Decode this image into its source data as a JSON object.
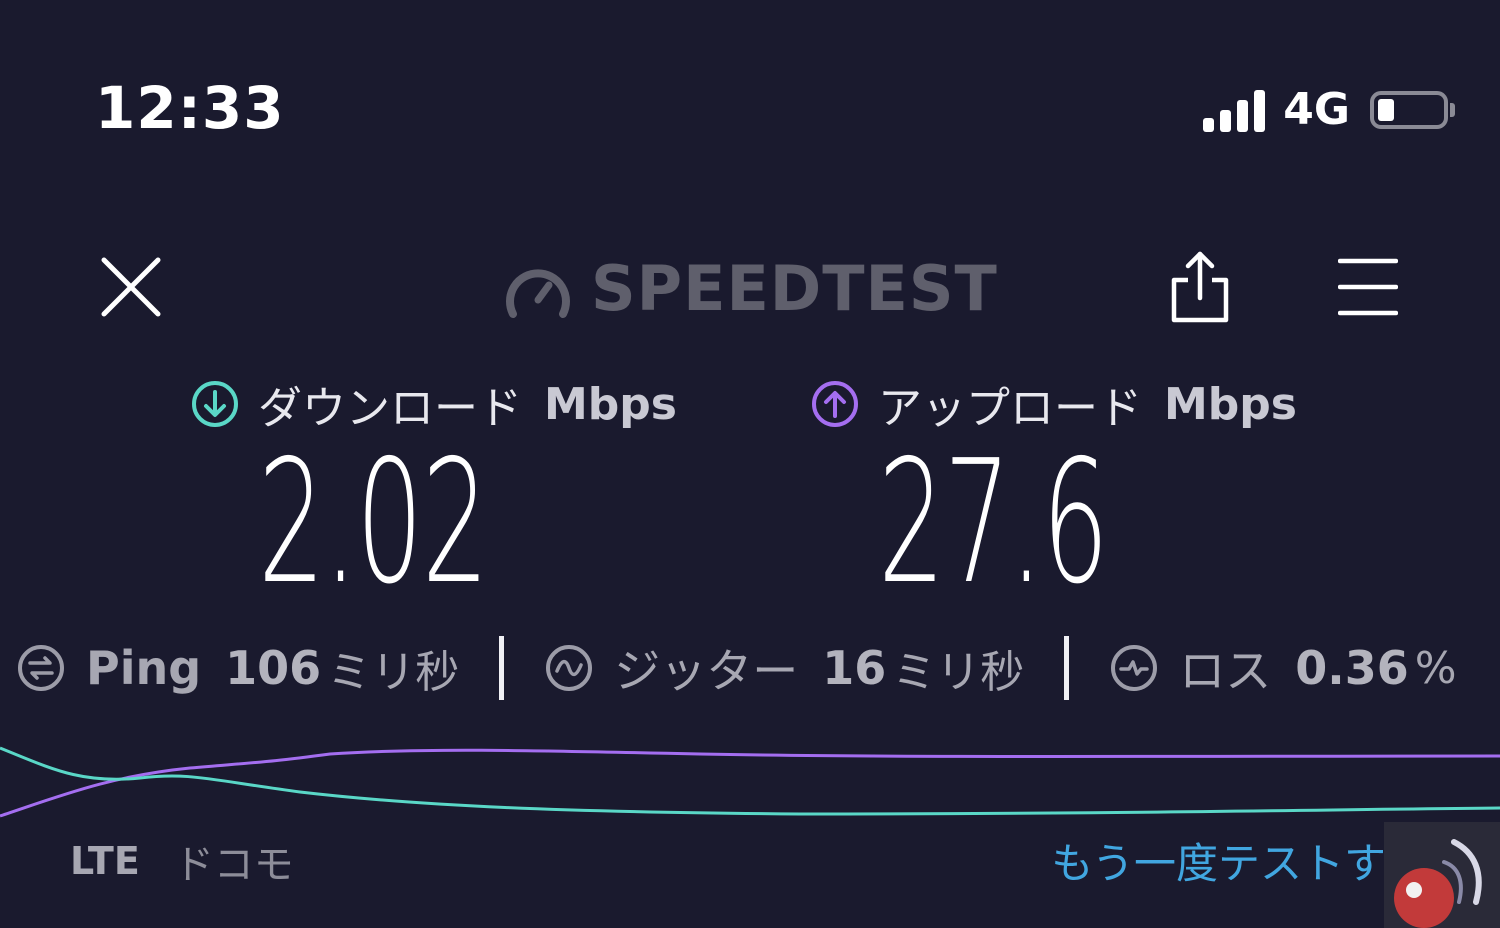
{
  "status_bar": {
    "time": "12:33",
    "network": "4G",
    "signal_bars": 4,
    "battery_level": 0.25
  },
  "header": {
    "logo_text": "SPEEDTEST",
    "icons": [
      "close-icon",
      "speedometer-icon",
      "share-icon",
      "menu-icon"
    ]
  },
  "download": {
    "label": "ダウンロード",
    "unit": "Mbps",
    "value": "2.02",
    "icon": "download-arrow-icon",
    "color": "#5ad7c7"
  },
  "upload": {
    "label": "アップロード",
    "unit": "Mbps",
    "value": "27.6",
    "icon": "upload-arrow-icon",
    "color": "#a46ef0"
  },
  "stats": {
    "ping": {
      "label": "Ping",
      "value": "106",
      "unit": "ミリ秒",
      "icon": "ping-icon"
    },
    "jitter": {
      "label": "ジッター",
      "value": "16",
      "unit": "ミリ秒",
      "icon": "jitter-icon"
    },
    "loss": {
      "label": "ロス",
      "value": "0.36",
      "unit": "%",
      "icon": "loss-icon"
    }
  },
  "carrier": {
    "technology": "LTE",
    "name": "ドコモ"
  },
  "actions": {
    "retry_label": "もう一度テストする"
  },
  "colors": {
    "background": "#1a1a2e",
    "download_line": "#5ad7c7",
    "upload_line": "#a46ef0",
    "link": "#41a6e0"
  }
}
